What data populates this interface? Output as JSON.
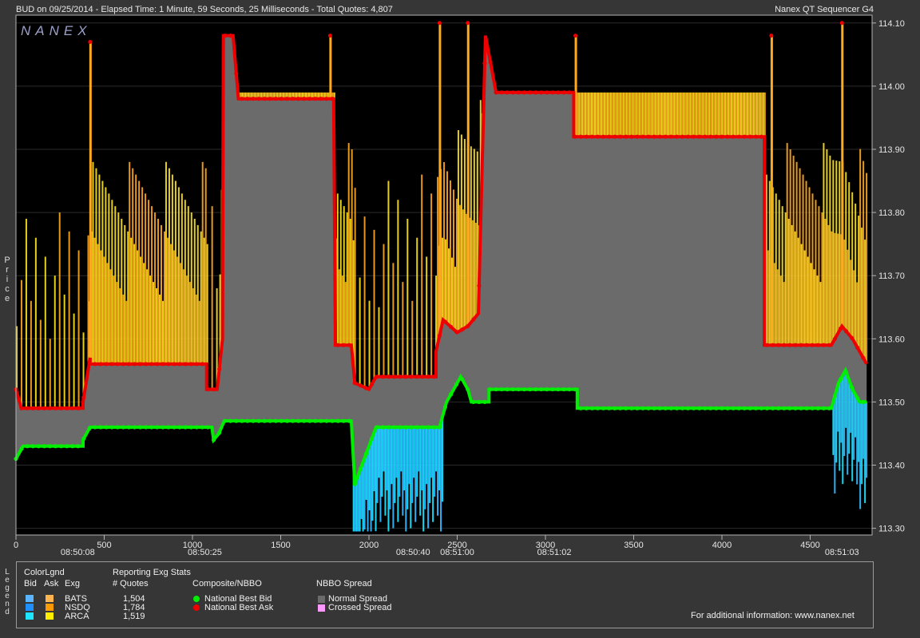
{
  "header": {
    "left_text": "BUD on 09/25/2014  -  Elapsed Time: 1 Minute, 59 Seconds, 25 Milliseconds  -  Total Quotes: 4,807",
    "right_text": "Nanex QT Sequencer G4",
    "logo_text": "NANEX"
  },
  "side_labels": {
    "price": "Price",
    "legend": "Legend"
  },
  "colors": {
    "background": "#000000",
    "spread": "#6b6b6b",
    "bid_dot": "#00ee00",
    "ask_dot": "#ee0000",
    "ask_fill_a": "#ffaa1e",
    "ask_fill_b": "#ffe61e",
    "bid_fill_a": "#35b8ff",
    "bid_fill_b": "#19e0ff",
    "frame": "#b4b4b4"
  },
  "chart_data": {
    "type": "line",
    "ylabel": "Price",
    "ylim": [
      113.29,
      114.11
    ],
    "xlim": [
      0,
      4820
    ],
    "y_ticks": [
      "113.30",
      "113.40",
      "113.50",
      "113.60",
      "113.70",
      "113.80",
      "113.90",
      "114.00",
      "114.10"
    ],
    "x_ticks": [
      "0",
      "500",
      "1000",
      "1500",
      "2000",
      "2500",
      "3000",
      "3500",
      "4000",
      "4500"
    ],
    "time_labels": [
      {
        "x": 350,
        "label": "08:50:08"
      },
      {
        "x": 1070,
        "label": "08:50:25"
      },
      {
        "x": 2250,
        "label": "08:50:40"
      },
      {
        "x": 2500,
        "label": "08:51:00"
      },
      {
        "x": 3050,
        "label": "08:51:02"
      },
      {
        "x": 4680,
        "label": "08:51:03"
      }
    ],
    "series": [
      {
        "name": "National Best Bid",
        "points": [
          [
            0,
            113.41
          ],
          [
            40,
            113.43
          ],
          [
            380,
            113.43
          ],
          [
            380,
            113.44
          ],
          [
            420,
            113.46
          ],
          [
            1110,
            113.46
          ],
          [
            1120,
            113.44
          ],
          [
            1150,
            113.45
          ],
          [
            1180,
            113.47
          ],
          [
            1900,
            113.47
          ],
          [
            1920,
            113.37
          ],
          [
            1960,
            113.4
          ],
          [
            2000,
            113.43
          ],
          [
            2040,
            113.46
          ],
          [
            2400,
            113.46
          ],
          [
            2440,
            113.5
          ],
          [
            2480,
            113.52
          ],
          [
            2520,
            113.54
          ],
          [
            2560,
            113.52
          ],
          [
            2580,
            113.5
          ],
          [
            2680,
            113.5
          ],
          [
            2680,
            113.52
          ],
          [
            3180,
            113.52
          ],
          [
            3180,
            113.49
          ],
          [
            4620,
            113.49
          ],
          [
            4660,
            113.53
          ],
          [
            4700,
            113.55
          ],
          [
            4740,
            113.52
          ],
          [
            4780,
            113.5
          ],
          [
            4820,
            113.5
          ]
        ]
      },
      {
        "name": "National Best Ask",
        "points": [
          [
            0,
            113.52
          ],
          [
            30,
            113.49
          ],
          [
            380,
            113.49
          ],
          [
            380,
            113.5
          ],
          [
            420,
            113.57
          ],
          [
            420,
            113.56
          ],
          [
            1080,
            113.56
          ],
          [
            1080,
            113.52
          ],
          [
            1140,
            113.52
          ],
          [
            1170,
            113.6
          ],
          [
            1175,
            114.08
          ],
          [
            1230,
            114.08
          ],
          [
            1260,
            113.98
          ],
          [
            1800,
            113.98
          ],
          [
            1810,
            113.59
          ],
          [
            1900,
            113.59
          ],
          [
            1920,
            113.53
          ],
          [
            2000,
            113.52
          ],
          [
            2040,
            113.54
          ],
          [
            2380,
            113.54
          ],
          [
            2380,
            113.58
          ],
          [
            2420,
            113.63
          ],
          [
            2500,
            113.61
          ],
          [
            2560,
            113.62
          ],
          [
            2620,
            113.64
          ],
          [
            2660,
            114.08
          ],
          [
            2720,
            113.99
          ],
          [
            3160,
            113.99
          ],
          [
            3160,
            113.92
          ],
          [
            4240,
            113.92
          ],
          [
            4240,
            113.59
          ],
          [
            4620,
            113.59
          ],
          [
            4680,
            113.62
          ],
          [
            4740,
            113.6
          ],
          [
            4820,
            113.56
          ]
        ]
      }
    ],
    "spikes": [
      [
        420,
        114.07
      ],
      [
        1780,
        114.08
      ],
      [
        2400,
        114.1
      ],
      [
        2560,
        114.1
      ],
      [
        3170,
        114.08
      ],
      [
        4280,
        114.08
      ],
      [
        4680,
        114.1
      ]
    ],
    "legend": [
      {
        "name": "National Best Bid",
        "marker": "dot",
        "color": "#00ee00"
      },
      {
        "name": "National Best Ask",
        "marker": "dot",
        "color": "#ee0000"
      },
      {
        "name": "Normal Spread",
        "marker": "square",
        "color": "#6b6b6b"
      },
      {
        "name": "Crossed Spread",
        "marker": "square",
        "color": "#ff99ff"
      }
    ]
  },
  "legend": {
    "color_legend_title": "ColorLgnd",
    "col_bid": "Bid",
    "col_ask": "Ask",
    "col_exg": "Exg",
    "reporting_title": "Reporting Exg Stats",
    "quotes_header": "# Quotes",
    "composite_title": "Composite/NBBO",
    "spread_title": "NBBO Spread",
    "footer": "For additional information: www.nanex.net",
    "exchanges": [
      {
        "name": "BATS",
        "quotes": "1,504",
        "bid_color": "#5ab4ff",
        "ask_color": "#ffb450"
      },
      {
        "name": "NSDQ",
        "quotes": "1,784",
        "bid_color": "#1e90ff",
        "ask_color": "#ff9a00"
      },
      {
        "name": "ARCA",
        "quotes": "1,519",
        "bid_color": "#1ee6ff",
        "ask_color": "#ffee00"
      }
    ]
  }
}
